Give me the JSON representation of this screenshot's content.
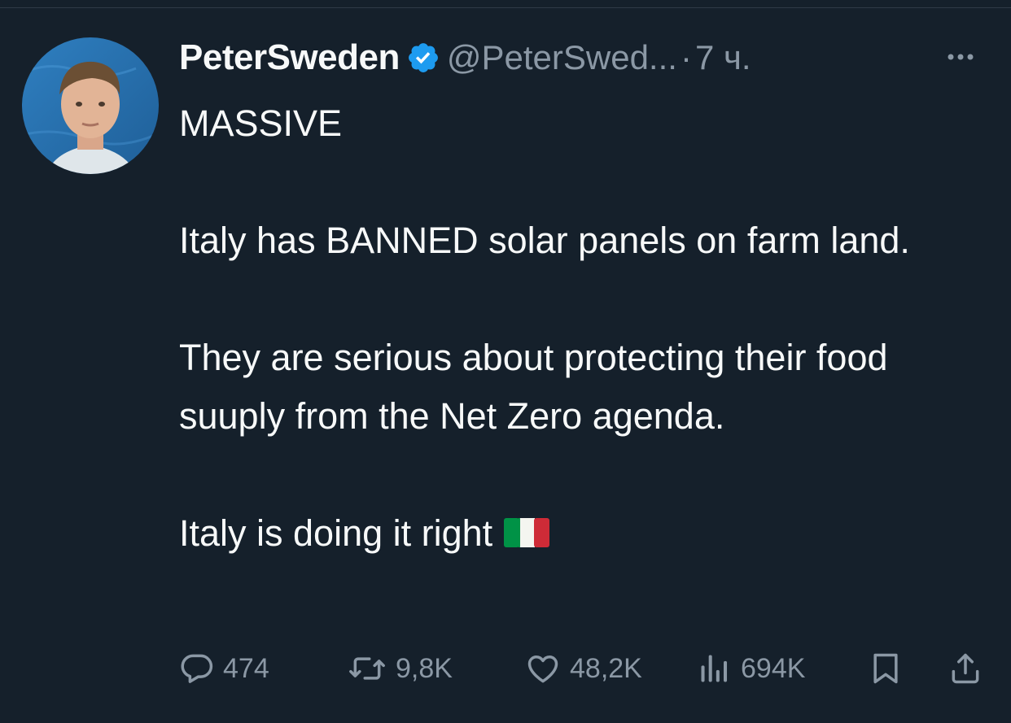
{
  "tweet": {
    "author_name": "PeterSweden",
    "handle": "@PeterSwed...",
    "separator": "·",
    "time": "7 ч.",
    "text": "MASSIVE\n\nItaly has BANNED solar panels on farm land.\n\nThey are serious about protecting their food suuply from the Net Zero agenda.\n\nItaly is doing it right",
    "flag_emoji": "🇮🇹"
  },
  "actions": {
    "replies": "474",
    "reposts": "9,8K",
    "likes": "48,2K",
    "views": "694K"
  },
  "colors": {
    "background": "#15202b",
    "text": "#f7f9f9",
    "secondary": "#8b98a5",
    "verified": "#1d9bf0"
  },
  "icons": [
    "verified-badge-icon",
    "more-icon",
    "reply-icon",
    "repost-icon",
    "like-icon",
    "views-icon",
    "bookmark-icon",
    "share-icon"
  ]
}
